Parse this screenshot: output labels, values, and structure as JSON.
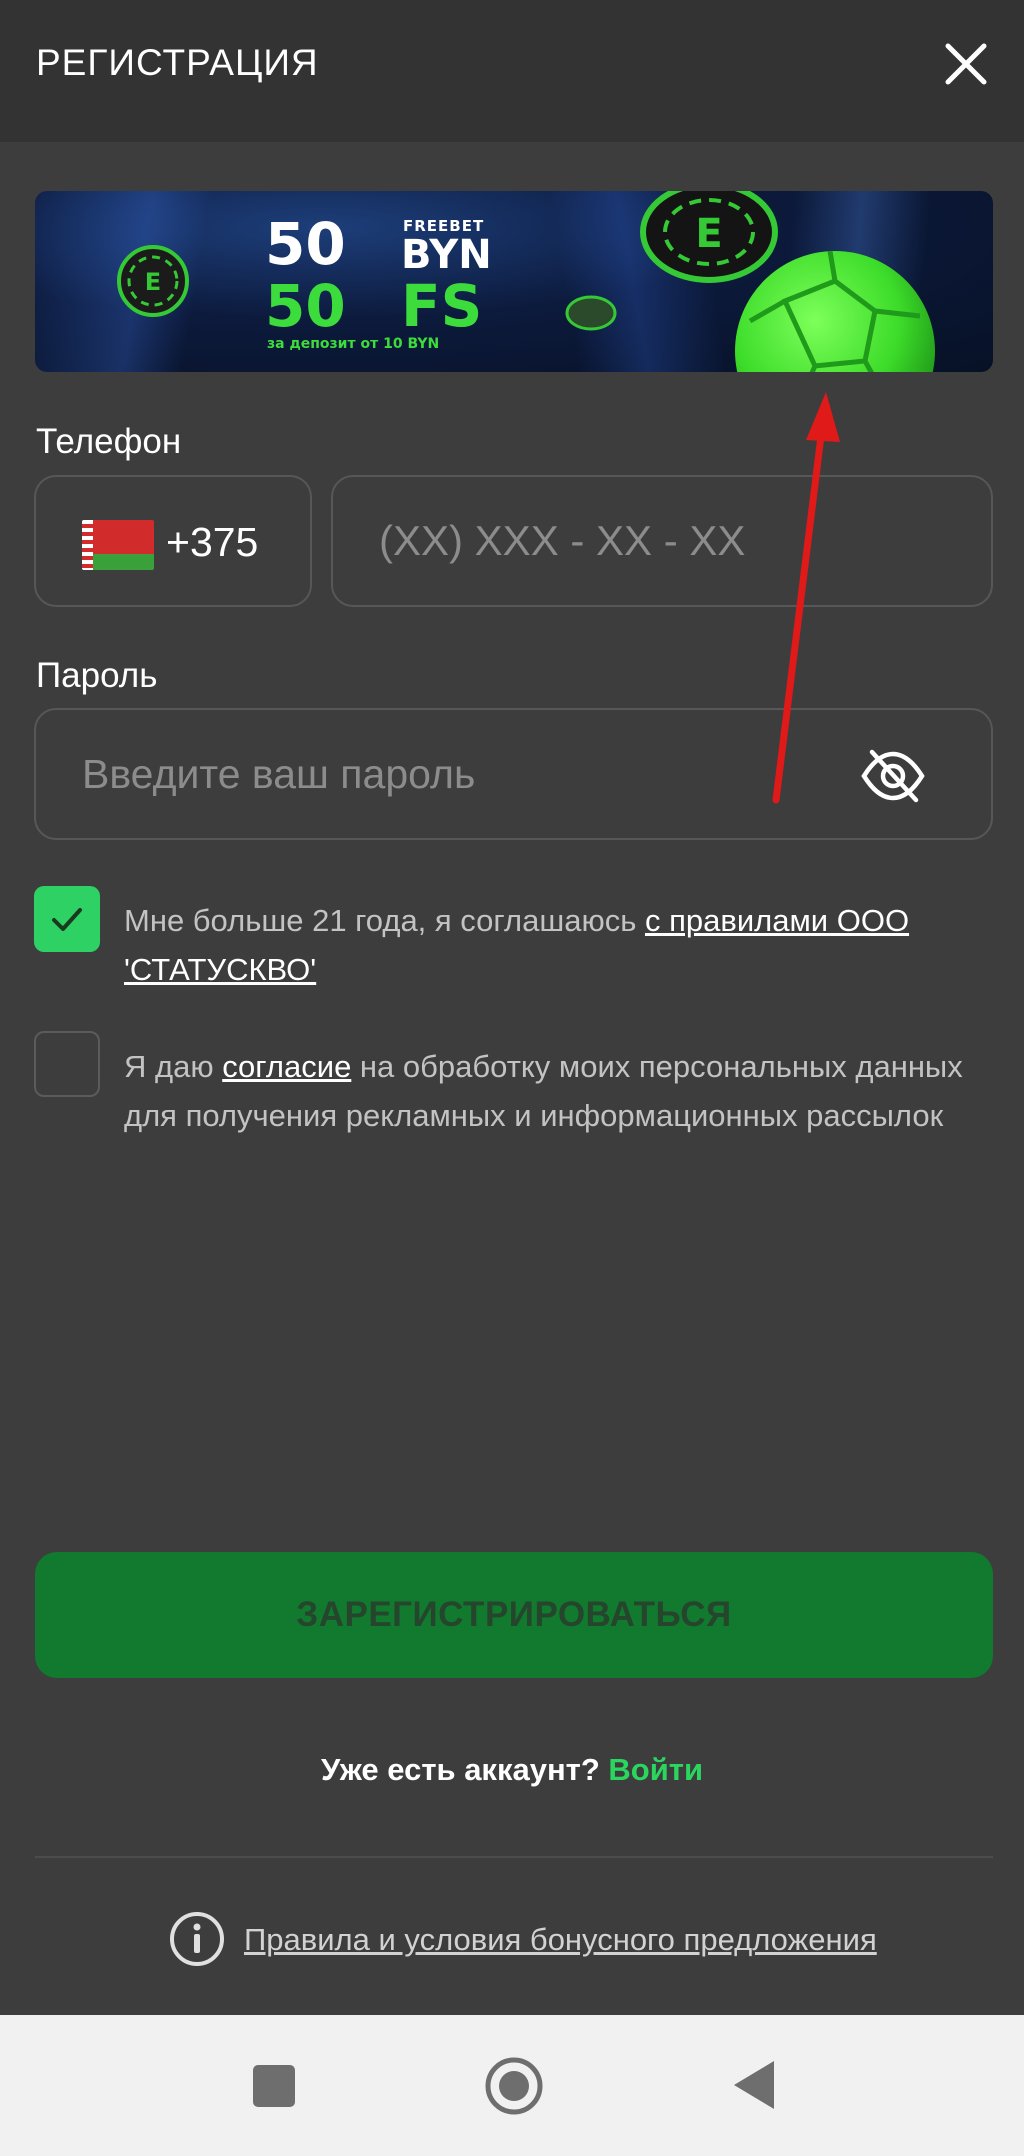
{
  "header": {
    "title": "РЕГИСТРАЦИЯ",
    "close_icon": "close-icon"
  },
  "banner": {
    "line1_amount": "50",
    "line1_label_small": "FREEBET",
    "line1_currency": "BYN",
    "line2_amount": "50",
    "line2_unit": "FS",
    "subtitle": "за депозит от 10 BYN",
    "colors": {
      "accent_green": "#3ddc3d",
      "background": "#0c1a3c"
    },
    "logo_letter": "E"
  },
  "form": {
    "phone_label": "Телефон",
    "country_code": "+375",
    "country_flag": "belarus-flag-icon",
    "phone_placeholder": "(XX) XXX - XX - XX",
    "password_label": "Пароль",
    "password_placeholder": "Введите ваш пароль",
    "password_toggle_icon": "eye-off-icon"
  },
  "checkboxes": [
    {
      "checked": true,
      "text": "Мне больше 21 года, я соглашаюсь ",
      "link": "с правилами ООО 'СТАТУСКВО'"
    },
    {
      "checked": false,
      "text_before": "Я даю ",
      "link": "согласие",
      "text_after": " на обработку моих персональных данных для получения рекламных и информационных рассылок"
    }
  ],
  "register_button": "ЗАРЕГИСТРИРОВАТЬСЯ",
  "login_prompt": {
    "text": "Уже есть аккаунт? ",
    "link": "Войти"
  },
  "bonus_rules_link": "Правила и условия бонусного предложения",
  "colors": {
    "background": "#3d3d3d",
    "header": "#333333",
    "primary_green": "#117a2e",
    "checkbox_green": "#2ed163",
    "link_green": "#2bd65f",
    "annotation_arrow": "#e01919"
  },
  "navbar": {
    "icons": [
      "recent-apps-icon",
      "home-icon",
      "back-icon"
    ]
  }
}
